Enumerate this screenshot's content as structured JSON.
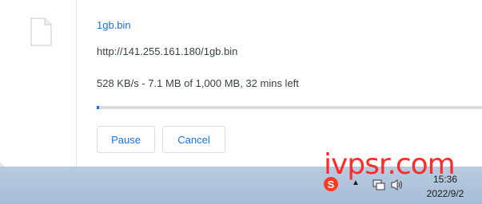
{
  "download": {
    "file_name": "1gb.bin",
    "url": "http://141.255.161.180/1gb.bin",
    "status": "528 KB/s - 7.1 MB of 1,000 MB, 32 mins left",
    "progress_percent": 0.71
  },
  "buttons": {
    "pause_label": "Pause",
    "cancel_label": "Cancel"
  },
  "watermark": {
    "text": "ivpsr.com"
  },
  "taskbar": {
    "time": "15:36",
    "date": "2022/9/2",
    "tray_icons": [
      "sogou-ime-icon",
      "show-hidden-icons-arrow",
      "network-icon",
      "volume-icon"
    ]
  },
  "colors": {
    "accent": "#1a73e8",
    "watermark": "#ff2b2b",
    "taskbar": "#b0c4dc"
  }
}
